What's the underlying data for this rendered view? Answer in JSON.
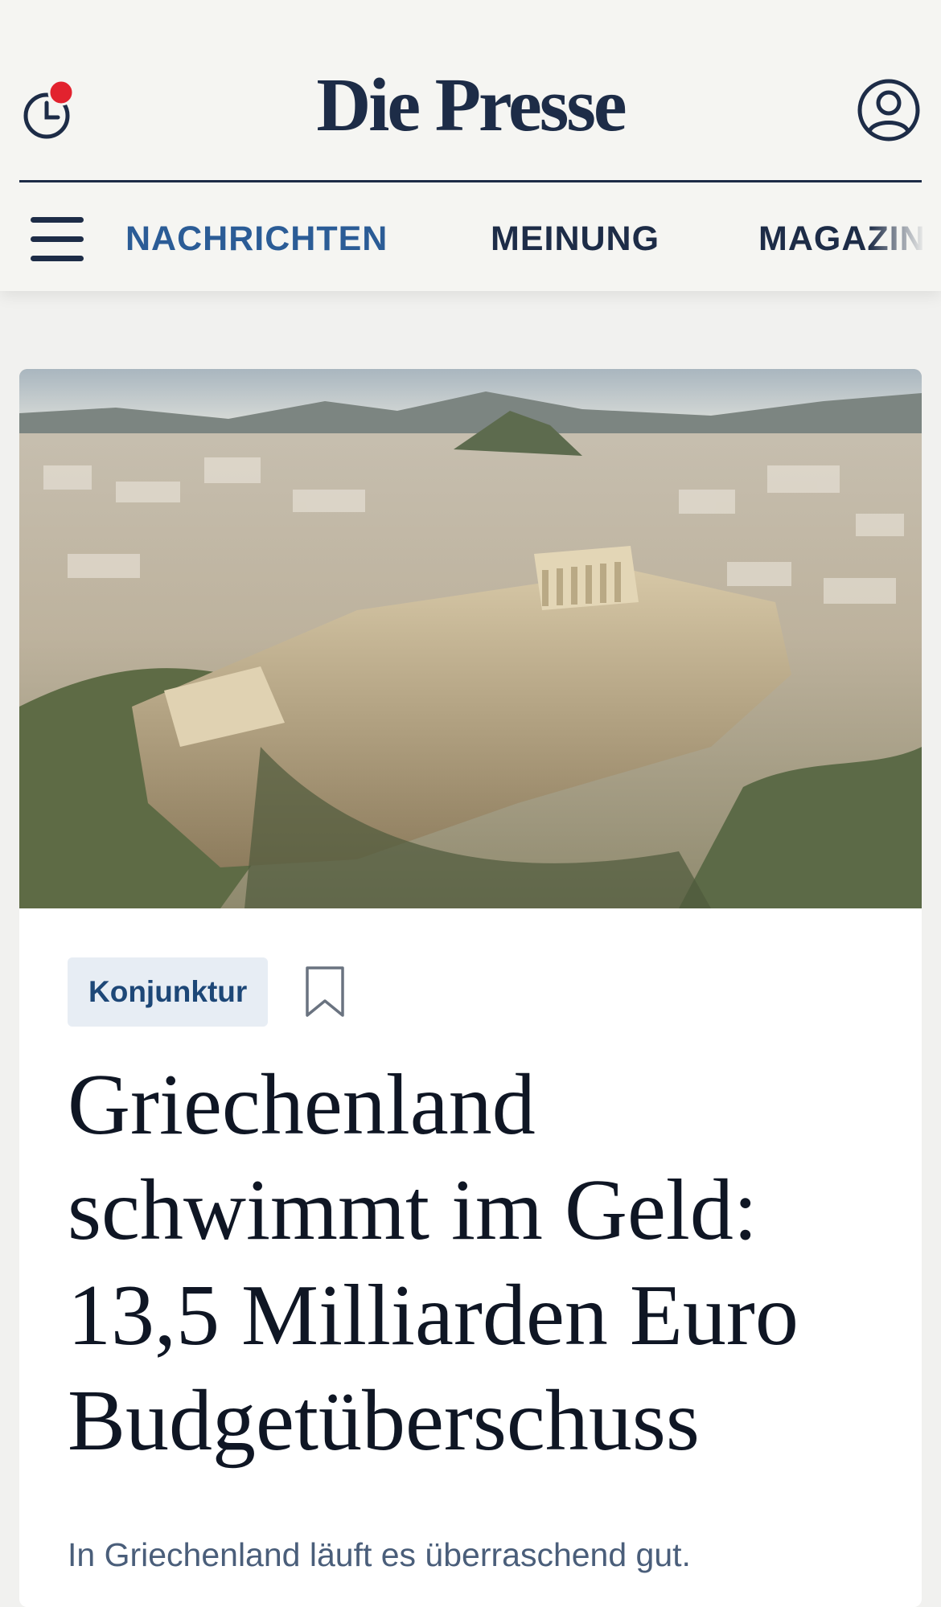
{
  "header": {
    "logo": "Die Presse",
    "history_icon": "clock-icon",
    "notification_dot_color": "#e2222e",
    "account_icon": "user-circle-icon",
    "menu_icon": "hamburger-menu-icon"
  },
  "nav": {
    "items": [
      {
        "label": "NACHRICHTEN",
        "active": true
      },
      {
        "label": "MEINUNG",
        "active": false
      },
      {
        "label": "MAGAZIN",
        "active": false
      }
    ]
  },
  "article": {
    "image_description_icon": "hero-image",
    "category": "Konjunktur",
    "bookmark_icon": "bookmark-icon",
    "headline": "Griechenland schwimmt im Geld: 13,5 Milliarden Euro Budgetüberschuss",
    "lead": "In Griechenland läuft es überraschend gut."
  },
  "colors": {
    "brand": "#1d2c47",
    "nav_active": "#2b5c96",
    "tag_bg": "#e7edf4",
    "lead_text": "#4a5e7a"
  }
}
